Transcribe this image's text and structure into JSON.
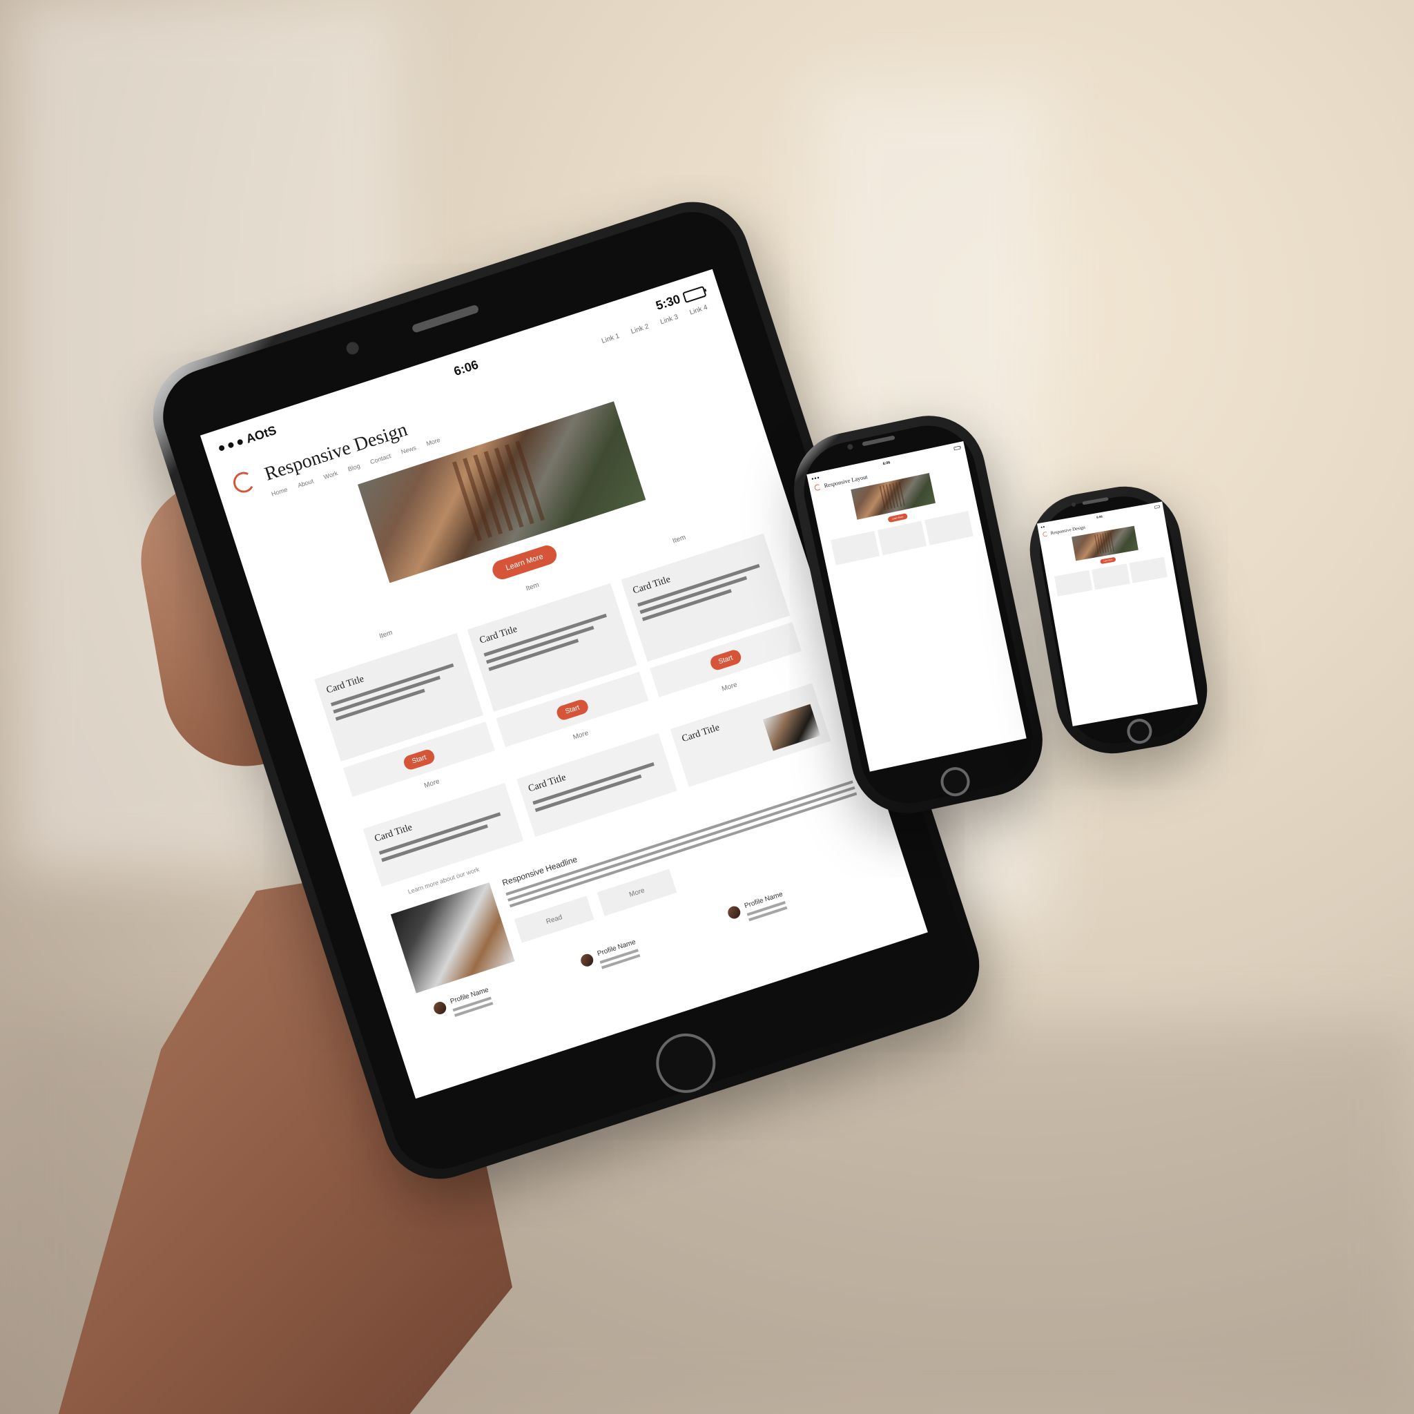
{
  "main_screen": {
    "status": {
      "left": "AOtS",
      "center": "6:06",
      "right": "5:30"
    },
    "top_menu": [
      "Link 1",
      "Link 2",
      "Link 3",
      "Link 4"
    ],
    "site_title": "Responsive Design",
    "subnav": [
      "Home",
      "About",
      "Work",
      "Blog",
      "Contact",
      "News",
      "More"
    ],
    "cta_label": "Learn More",
    "section_labels": [
      "Item",
      "Item",
      "Item"
    ],
    "cards": [
      {
        "title": "Card Title"
      },
      {
        "title": "Card Title"
      },
      {
        "title": "Card Title"
      }
    ],
    "mini_buttons": [
      "Start",
      "Start",
      "Start"
    ],
    "mini_labels": [
      "More",
      "More",
      "More"
    ],
    "lower_cards": [
      {
        "title": "Card Title"
      },
      {
        "title": "Card Title"
      },
      {
        "title": "Card Title"
      }
    ],
    "small_caption": "Learn more about our work",
    "content_heading": "Responsive Headline",
    "content_action_primary": "Read",
    "content_action_secondary": "More",
    "profiles": [
      {
        "name": "Profile Name"
      },
      {
        "name": "Profile Name"
      },
      {
        "name": "Profile Name"
      }
    ]
  },
  "secondary_screen": {
    "title": "Responsive Layout"
  },
  "colors": {
    "accent": "#d65539",
    "text": "#1d1d1d",
    "muted": "#777777",
    "card": "#efefef"
  },
  "icons": {
    "logo": "logo-icon",
    "menu": "menu-icon",
    "battery": "battery-icon"
  }
}
